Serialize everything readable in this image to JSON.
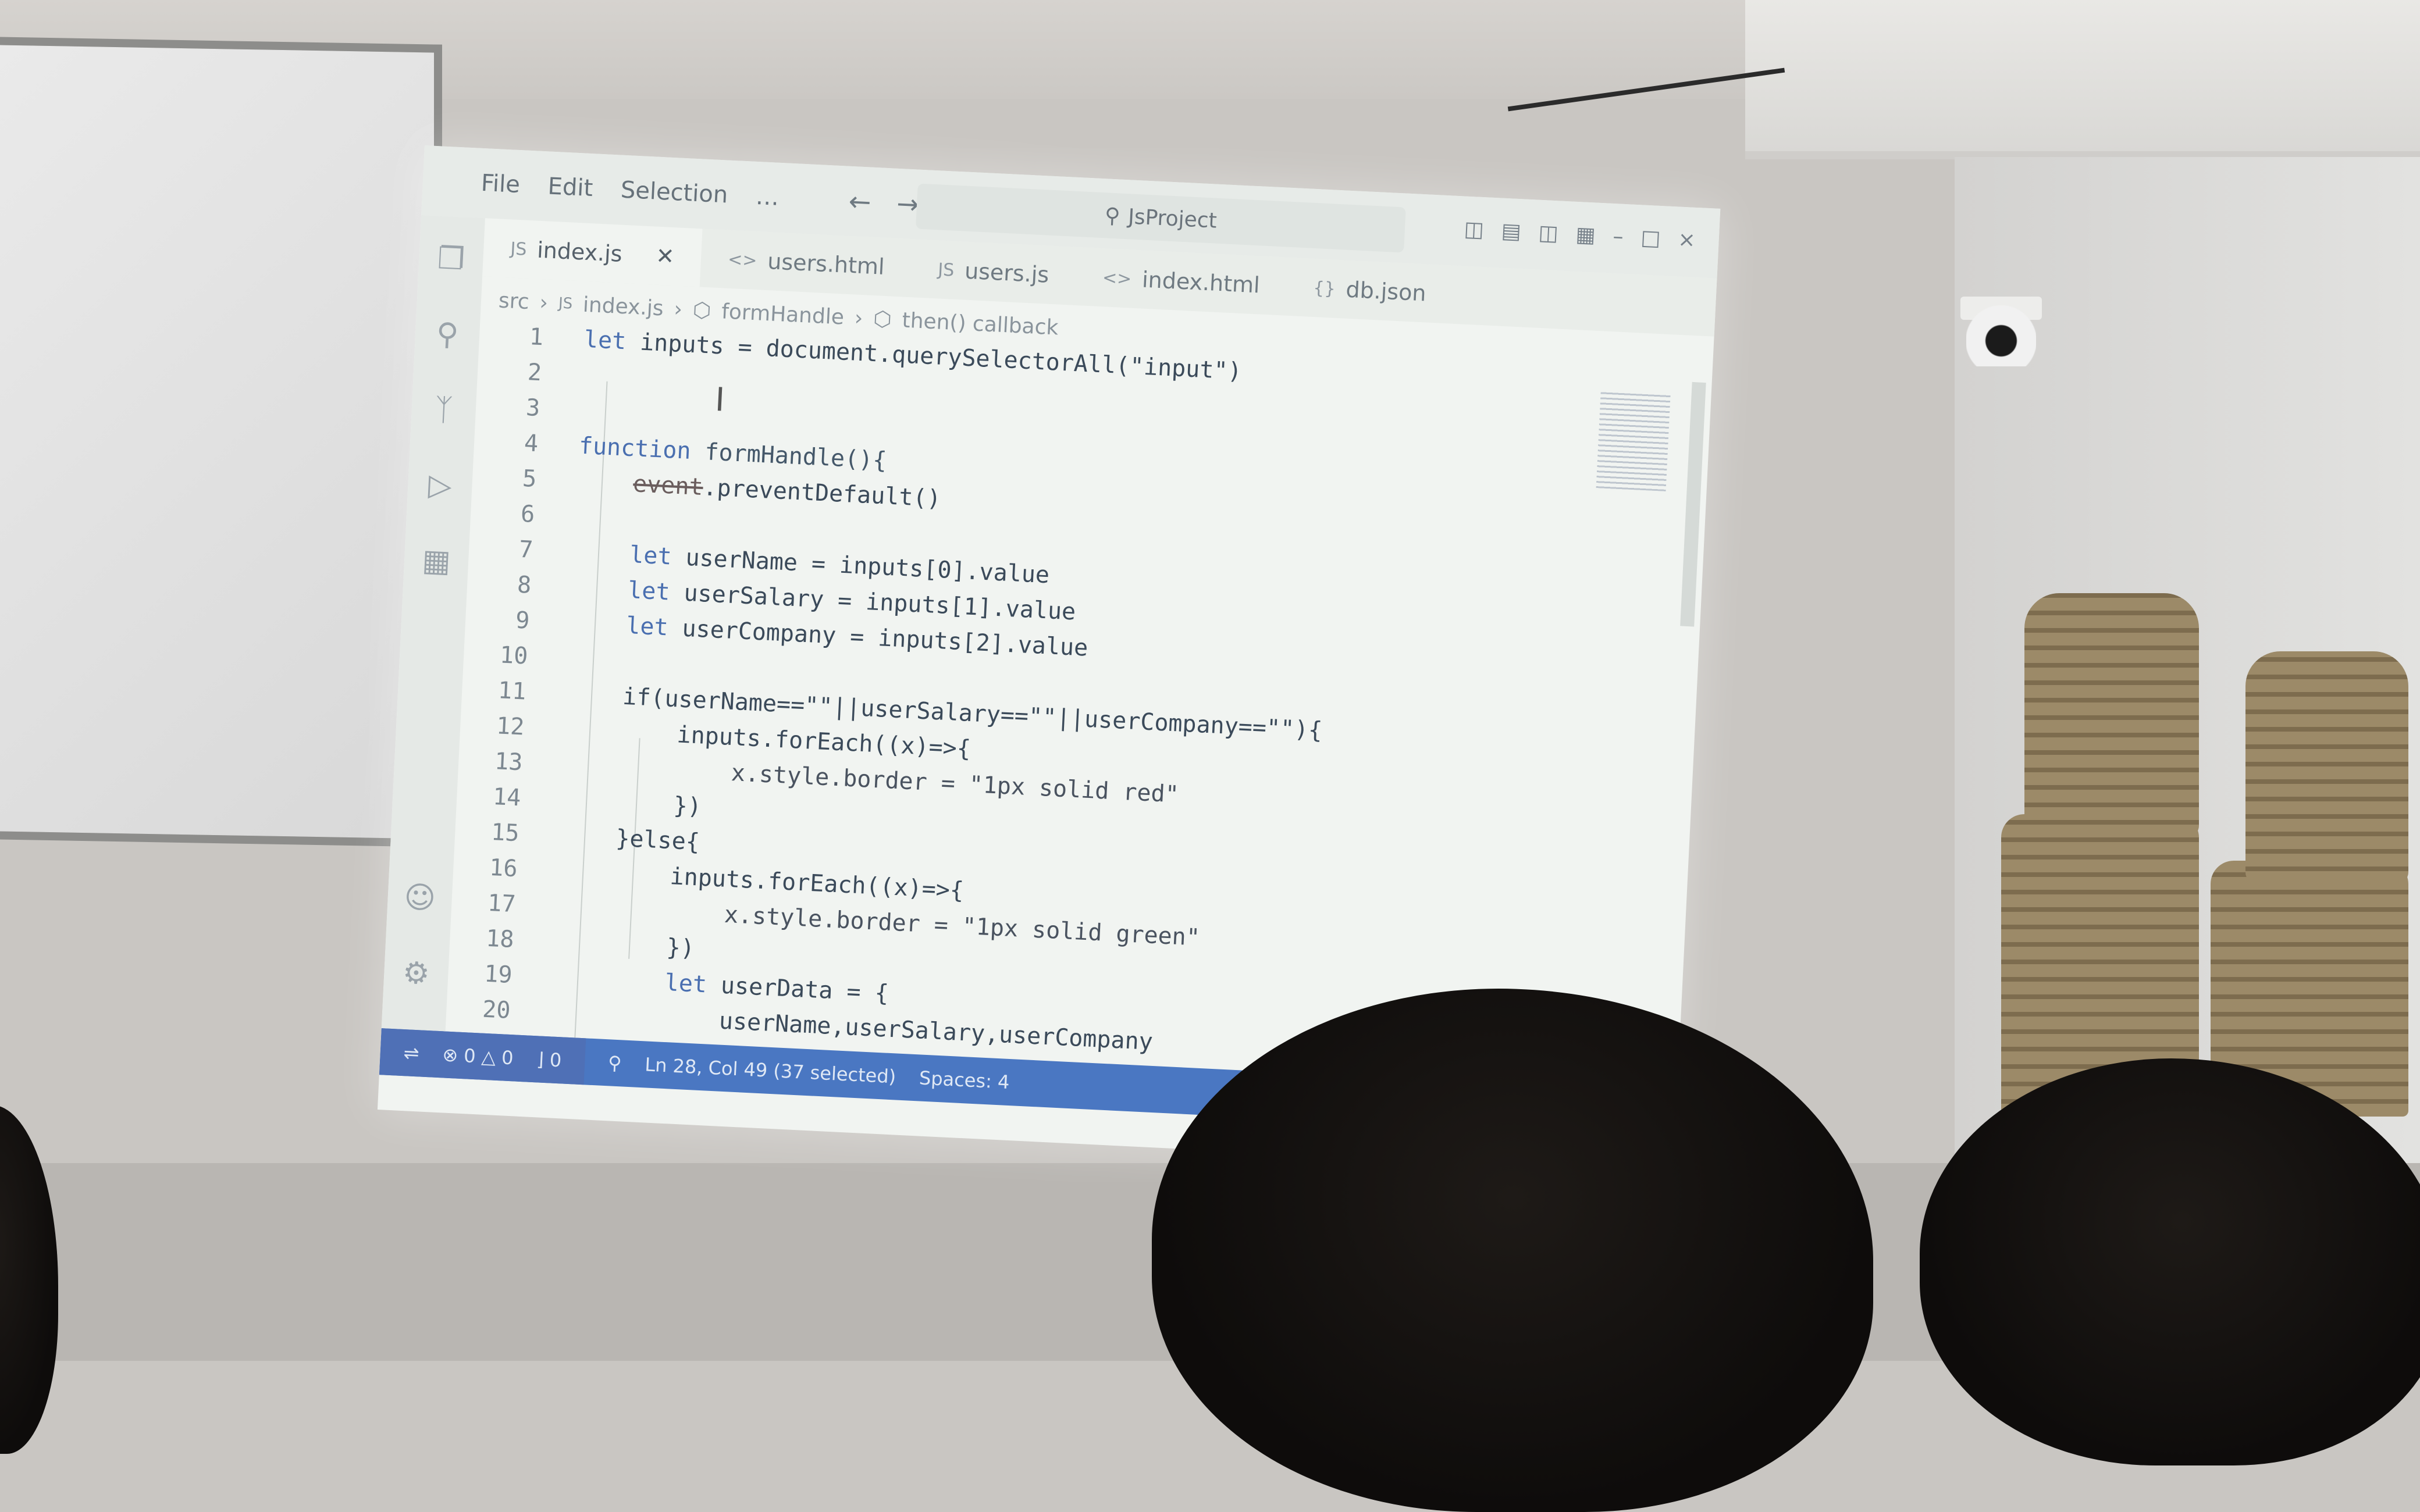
{
  "titlebar": {
    "menu": [
      "File",
      "Edit",
      "Selection",
      "…"
    ],
    "search": "JsProject"
  },
  "tabs": [
    {
      "label": "index.js",
      "icon": "js-file-icon",
      "close": "✕"
    },
    {
      "label": "users.html",
      "icon": "html-file-icon"
    },
    {
      "label": "users.js",
      "icon": "js-file-icon"
    },
    {
      "label": "index.html",
      "icon": "html-file-icon"
    },
    {
      "label": "db.json",
      "icon": "json-file-icon"
    }
  ],
  "breadcrumb": {
    "folder": "src",
    "file": "index.js",
    "function": "formHandle",
    "callback": "then() callback"
  },
  "code": {
    "line_numbers": [
      "1",
      "2",
      "3",
      "4",
      "5",
      "6",
      "7",
      "8",
      "9",
      "10",
      "11",
      "12",
      "13",
      "14",
      "15",
      "16",
      "17",
      "18",
      "19",
      "20"
    ],
    "l1_kw": "let",
    "l1_rest": " inputs = document.querySelectorAll(\"input\")",
    "l4_kw": "function",
    "l4_rest": " formHandle(){",
    "l5_strike": "event",
    "l5_rest": ".preventDefault()",
    "l7_kw": "let",
    "l7_rest": " userName = inputs[0].value",
    "l8_kw": "let",
    "l8_rest": " userSalary = inputs[1].value",
    "l9_kw": "let",
    "l9_rest": " userCompany = inputs[2].value",
    "l11": "if(userName==\"\"||userSalary==\"\"||userCompany==\"\"){",
    "l12": "inputs.forEach((x)=>{",
    "l13": "x.style.border = \"1px solid red\"",
    "l14": "})",
    "l15": "}else{",
    "l16": "inputs.forEach((x)=>{",
    "l17": "x.style.border = \"1px solid green\"",
    "l18": "})",
    "l19_kw": "let",
    "l19_rest": " userData = {",
    "l20": "userName,userSalary,userCompany"
  },
  "statusbar": {
    "errors": "0",
    "warnings": "0",
    "ports": "0",
    "position": "Ln 28, Col 49 (37 selected)",
    "spaces": "Spaces: 4"
  },
  "colors": {
    "keyword": "#4a6fb0",
    "statusbar": "#4a77c2"
  }
}
